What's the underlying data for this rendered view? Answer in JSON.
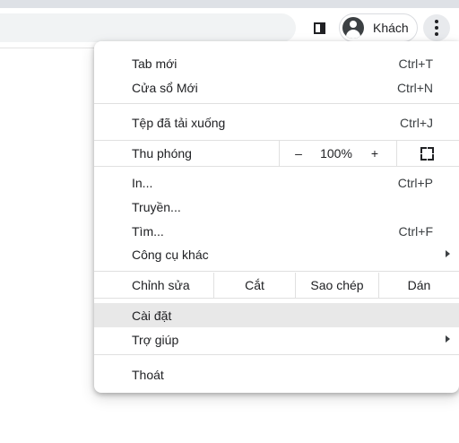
{
  "toolbar": {
    "profile_name": "Khách",
    "side_panel_icon": "side-panel-icon",
    "avatar_icon": "guest-avatar-icon",
    "menu_icon": "more-vertical-icon"
  },
  "menu": {
    "new_tab": {
      "label": "Tab mới",
      "shortcut": "Ctrl+T"
    },
    "new_window": {
      "label": "Cửa sổ Mới",
      "shortcut": "Ctrl+N"
    },
    "downloads": {
      "label": "Tệp đã tải xuống",
      "shortcut": "Ctrl+J"
    },
    "zoom": {
      "label": "Thu phóng",
      "minus": "–",
      "value": "100%",
      "plus": "+",
      "fullscreen_icon": "fullscreen-icon"
    },
    "print": {
      "label": "In...",
      "shortcut": "Ctrl+P"
    },
    "cast": {
      "label": "Truyền..."
    },
    "find": {
      "label": "Tìm...",
      "shortcut": "Ctrl+F"
    },
    "more_tools": {
      "label": "Công cụ khác"
    },
    "edit": {
      "label": "Chỉnh sửa",
      "cut": "Cắt",
      "copy": "Sao chép",
      "paste": "Dán"
    },
    "settings": {
      "label": "Cài đặt"
    },
    "help": {
      "label": "Trợ giúp"
    },
    "exit": {
      "label": "Thoát"
    }
  },
  "colors": {
    "menu_background": "#ffffff",
    "hover_background": "#e8e8e8",
    "separator": "#e0e0e0",
    "text": "#202124"
  }
}
